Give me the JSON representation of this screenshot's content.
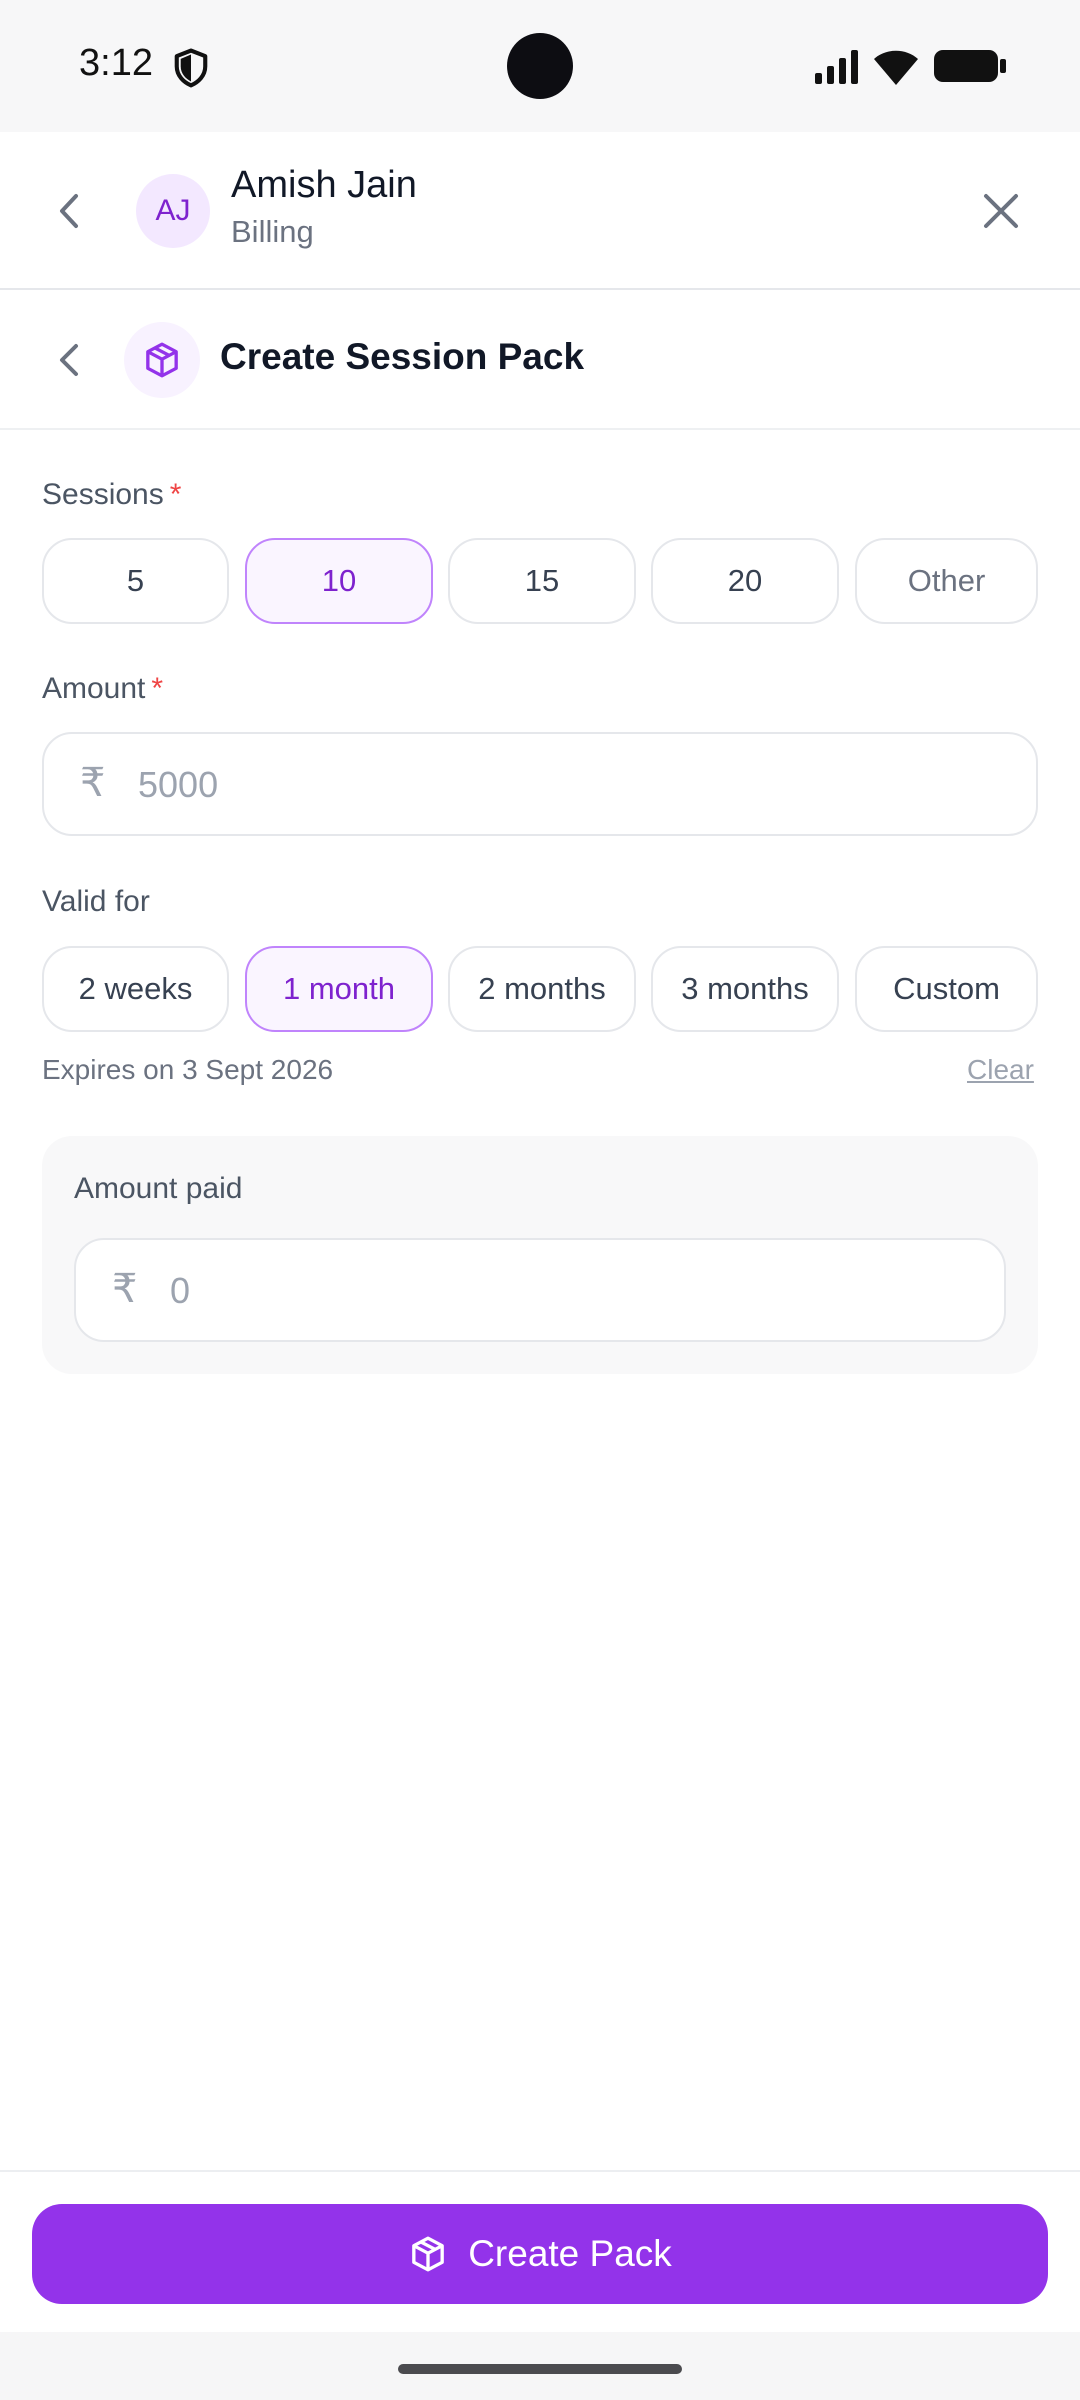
{
  "status_bar": {
    "time": "3:12"
  },
  "header": {
    "avatar_initials": "AJ",
    "client_name": "Amish Jain",
    "client_subtitle": "Billing"
  },
  "subheader": {
    "title": "Create Session Pack"
  },
  "form": {
    "sessions": {
      "label": "Sessions",
      "required_mark": "*",
      "options": [
        "5",
        "10",
        "15",
        "20",
        "Other"
      ],
      "selected": "10"
    },
    "amount": {
      "label": "Amount",
      "required_mark": "*",
      "currency_symbol": "₹",
      "placeholder": "5000"
    },
    "valid_for": {
      "label": "Valid for",
      "options": [
        "2 weeks",
        "1 month",
        "2 months",
        "3 months",
        "Custom"
      ],
      "selected": "1 month",
      "expiry_text": "Expires on 3 Sept 2026",
      "clear_label": "Clear"
    },
    "amount_paid": {
      "label": "Amount paid",
      "currency_symbol": "₹",
      "placeholder": "0"
    }
  },
  "footer": {
    "create_button_label": "Create Pack"
  },
  "colors": {
    "accent": "#9333ea",
    "accent_text": "#7e22ce",
    "selected_chip_bg": "#faf5ff",
    "required": "#ef4444"
  },
  "icons": [
    "shield-icon",
    "signal-icon",
    "wifi-icon",
    "battery-icon",
    "chevron-left-icon",
    "close-icon",
    "package-icon"
  ]
}
